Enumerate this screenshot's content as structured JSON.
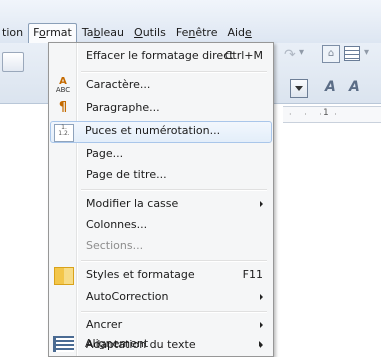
{
  "menubar": {
    "items": [
      {
        "label": "tion"
      },
      {
        "label": "Format"
      },
      {
        "label": "Tableau"
      },
      {
        "label": "Outils"
      },
      {
        "label": "Fenêtre"
      },
      {
        "label": "Aide"
      }
    ]
  },
  "toolbar": {
    "ruler_number": "1"
  },
  "menu": {
    "items": [
      {
        "label": "Effacer le formatage direct",
        "shortcut": "Ctrl+M"
      },
      {
        "label": "Caractère..."
      },
      {
        "label": "Paragraphe..."
      },
      {
        "label": "Puces et numérotation..."
      },
      {
        "label": "Page..."
      },
      {
        "label": "Page de titre..."
      },
      {
        "label": "Modifier la casse"
      },
      {
        "label": "Colonnes..."
      },
      {
        "label": "Sections..."
      },
      {
        "label": "Styles et formatage",
        "shortcut": "F11"
      },
      {
        "label": "AutoCorrection"
      },
      {
        "label": "Ancrer"
      },
      {
        "label": "Adaptation du texte"
      },
      {
        "label": "Alignement"
      }
    ]
  },
  "icons": {
    "caractere": "character-abc-icon",
    "paragraphe": "paragraph-icon",
    "puces": "bullets-numbering-icon",
    "styles": "styles-formatting-icon",
    "alignement": "alignment-icon"
  }
}
